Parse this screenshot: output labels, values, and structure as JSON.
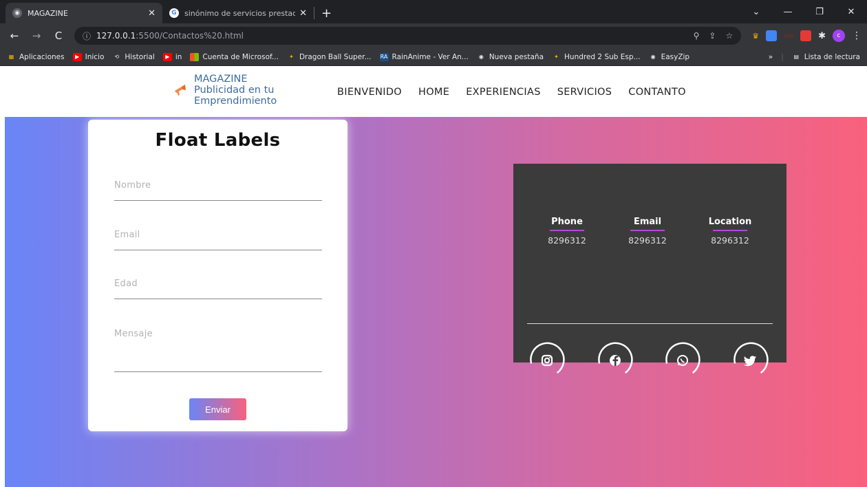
{
  "browser": {
    "tabs": [
      {
        "title": "MAGAZINE",
        "active": true
      },
      {
        "title": "sinónimo de servicios prestados",
        "active": false
      }
    ],
    "url_info": "ⓘ",
    "url_host": "127.0.0.1",
    "url_path": ":5500/Contactos%20.html",
    "bookmarks": [
      {
        "label": "Aplicaciones",
        "icon": "apps-icon",
        "color": "#f4b400"
      },
      {
        "label": "Inicio",
        "icon": "youtube-icon",
        "color": "#ff0000"
      },
      {
        "label": "Historial",
        "icon": "history-icon",
        "color": ""
      },
      {
        "label": "in",
        "icon": "youtube-icon",
        "color": "#ff0000"
      },
      {
        "label": "Cuenta de Microsof...",
        "icon": "microsoft-icon",
        "color": "#f35325"
      },
      {
        "label": "Dragon Ball Super...",
        "icon": "star-icon",
        "color": "#e6b800"
      },
      {
        "label": "RainAnime - Ver An...",
        "icon": "ra-icon",
        "color": "#1a4f8b"
      },
      {
        "label": "Nueva pestaña",
        "icon": "globe-icon",
        "color": ""
      },
      {
        "label": "Hundred 2 Sub Esp...",
        "icon": "star-icon",
        "color": "#e6b800"
      },
      {
        "label": "EasyZip",
        "icon": "globe-icon",
        "color": ""
      }
    ],
    "bookmarks_more": "»",
    "reading_list": "Lista de lectura",
    "profile_initial": "c"
  },
  "site": {
    "logo_line1": "MAGAZINE",
    "logo_line2": "Publicidad en tu",
    "logo_line3": "Emprendimiento",
    "nav": [
      "BIENVENIDO",
      "HOME",
      "EXPERIENCIAS",
      "SERVICIOS",
      "CONTANTO"
    ]
  },
  "form": {
    "title": "Float Labels",
    "fields": [
      {
        "label": "Nombre"
      },
      {
        "label": "Email"
      },
      {
        "label": "Edad"
      },
      {
        "label": "Mensaje"
      }
    ],
    "submit": "Enviar"
  },
  "contact": {
    "items": [
      {
        "label": "Phone",
        "value": "8296312"
      },
      {
        "label": "Email",
        "value": "8296312"
      },
      {
        "label": "Location",
        "value": "8296312"
      }
    ],
    "social": [
      "instagram-icon",
      "facebook-icon",
      "whatsapp-icon",
      "twitter-icon"
    ]
  },
  "colors": {
    "gradient_start": "#6a85f7",
    "gradient_end": "#f9617d",
    "accent_underline": "#b04ad8",
    "info_box": "#3b3b3b"
  }
}
